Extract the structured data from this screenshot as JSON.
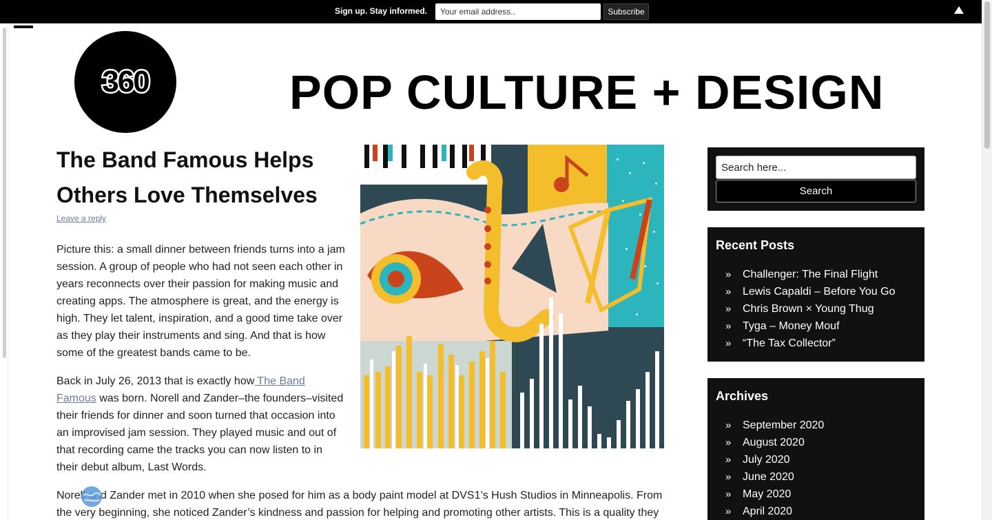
{
  "signup": {
    "label": "Sign up. Stay informed.",
    "email_placeholder": "Your email address..",
    "subscribe_label": "Subscribe"
  },
  "site": {
    "logo_text": "360",
    "title": "POP CULTURE + DESIGN"
  },
  "post": {
    "title": "The Band Famous Helps Others Love Themselves",
    "leave_reply": "Leave a reply",
    "p1": "Picture this: a small dinner between friends turns into a jam session. A group of people who had not seen each other in years reconnects over their passion for making music and creating apps. The atmosphere is great, and the energy is high. They let talent, inspiration, and a good time take over as they play their instruments and sing. And that is how some of the greatest bands came to be.",
    "p2_before": "Back in July 26, 2013 that is exactly how",
    "p2_link": " The Band Famous",
    "p2_after": " was born. Norell and Zander–the founders–visited their friends for dinner and soon turned that occasion into an improvised jam session. They played music and out of that recording came the tracks you can now listen to in their debut album, Last Words.",
    "p3": "Norell and Zander met in 2010 when she posed for him as a body paint model at DVS1’s Hush Studios in Minneapolis. From the very beginning, she noticed Zander’s kindness and passion for helping and promoting other artists. This is a quality they"
  },
  "sidebar": {
    "search_placeholder": "Search here...",
    "search_button": "Search",
    "recent_title": "Recent Posts",
    "recent": [
      "Challenger: The Final Flight",
      "Lewis Capaldi – Before You Go",
      "Chris Brown × Young Thug",
      "Tyga – Money Mouf",
      "“The Tax Collector”"
    ],
    "archives_title": "Archives",
    "archives": [
      "September 2020",
      "August 2020",
      "July 2020",
      "June 2020",
      "May 2020",
      "April 2020"
    ]
  },
  "colors": {
    "art_yellow": "#f4bd2b",
    "art_teal": "#2cb5bd",
    "art_navy": "#2f4954",
    "art_peach": "#f7d9c4",
    "art_red": "#c9431b"
  },
  "icons": {
    "collapse": "triangle-up-icon",
    "menu": "menu-icon",
    "list_bullet": "double-chevron-right-icon",
    "floating": "globe-icon"
  }
}
